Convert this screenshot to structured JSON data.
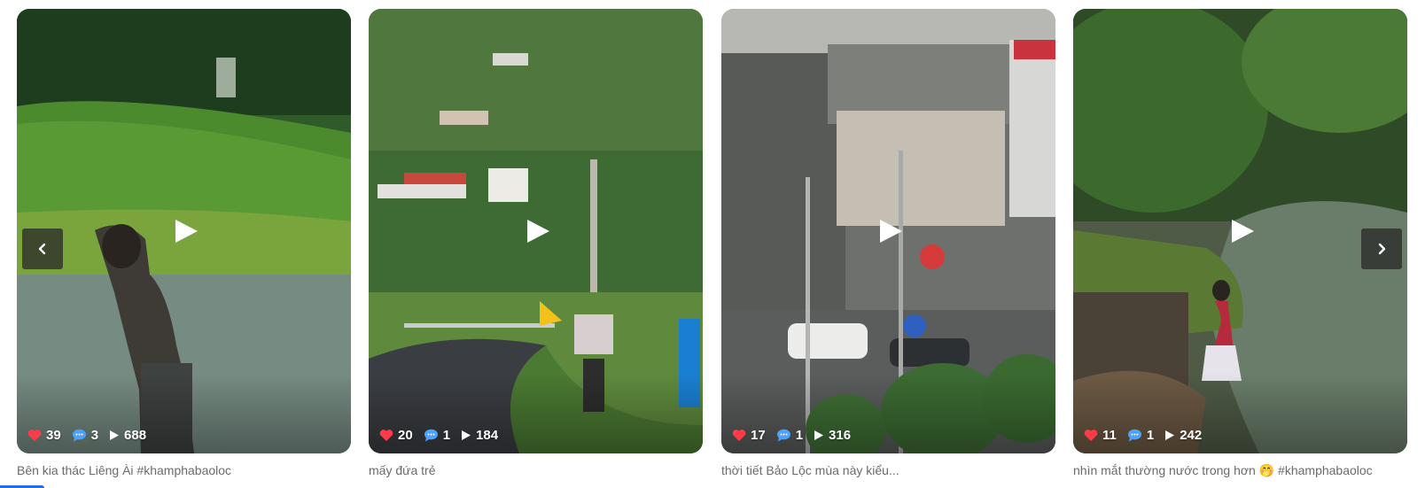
{
  "cards": [
    {
      "likes": "39",
      "comments": "3",
      "views": "688",
      "caption": "Bên kia thác Liêng Ài #khamphabaoloc"
    },
    {
      "likes": "20",
      "comments": "1",
      "views": "184",
      "caption": "mấy đứa trẻ"
    },
    {
      "likes": "17",
      "comments": "1",
      "views": "316",
      "caption": "thời tiết Bảo Lộc mùa này kiểu..."
    },
    {
      "likes": "11",
      "comments": "1",
      "views": "242",
      "caption": "nhìn mắt thường nước trong hơn 🤭 #khamphabaoloc"
    }
  ],
  "nav": {
    "prev_icon": "chevron-left-icon",
    "next_icon": "chevron-right-icon"
  },
  "colors": {
    "like": "#ff3b4a",
    "comment": "#4aa3ff",
    "accent": "#2a6bdc"
  }
}
